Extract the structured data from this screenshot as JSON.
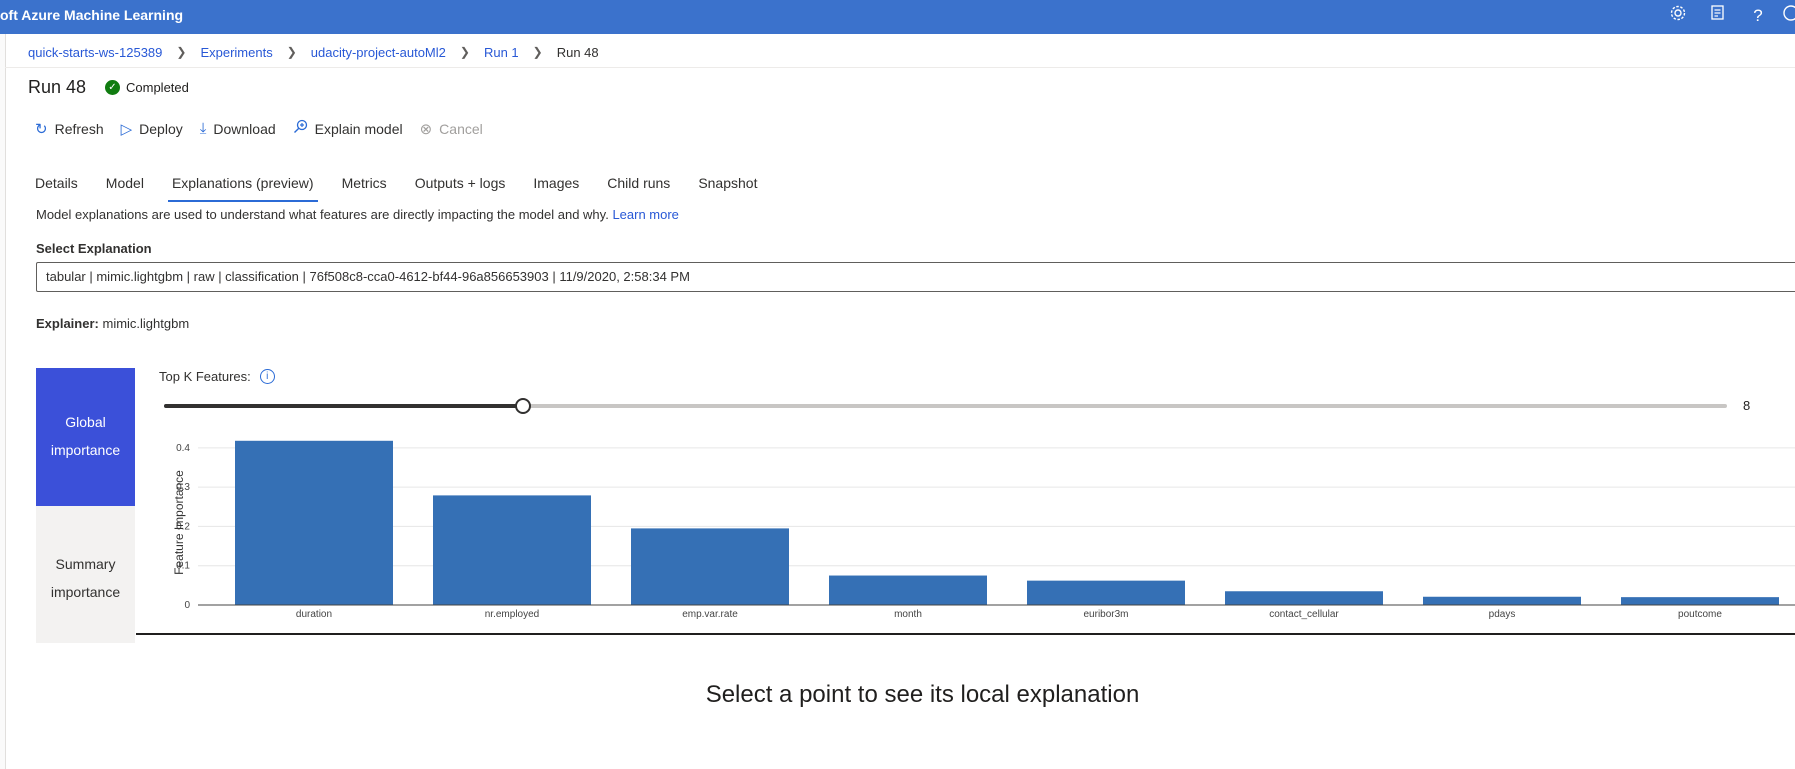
{
  "topbar": {
    "title": "oft Azure Machine Learning",
    "icons": [
      "gear-icon",
      "feedback-icon",
      "help-icon",
      "account-icon"
    ]
  },
  "breadcrumb": {
    "items": [
      "quick-starts-ws-125389",
      "Experiments",
      "udacity-project-autoMl2",
      "Run 1"
    ],
    "current": "Run 48"
  },
  "run": {
    "title": "Run 48",
    "status": "Completed"
  },
  "toolbar": {
    "refresh": "Refresh",
    "deploy": "Deploy",
    "download": "Download",
    "explain": "Explain model",
    "cancel": "Cancel"
  },
  "tabs": [
    {
      "label": "Details"
    },
    {
      "label": "Model"
    },
    {
      "label": "Explanations (preview)",
      "active": true
    },
    {
      "label": "Metrics"
    },
    {
      "label": "Outputs + logs"
    },
    {
      "label": "Images"
    },
    {
      "label": "Child runs"
    },
    {
      "label": "Snapshot"
    }
  ],
  "explanations": {
    "description": "Model explanations are used to understand what features are directly impacting the model and why.",
    "learn_more": "Learn more",
    "select_label": "Select Explanation",
    "selected_value": "tabular | mimic.lightgbm | raw | classification | 76f508c8-cca0-4612-bf44-96a856653903 | 11/9/2020, 2:58:34 PM",
    "explainer_label": "Explainer:",
    "explainer_value": "mimic.lightgbm",
    "side_tabs": {
      "global": "Global importance",
      "summary": "Summary importance"
    },
    "topk_label": "Top K Features:",
    "topk_value": "8",
    "topk_fraction": 0.23,
    "local_message": "Select a point to see its local explanation"
  },
  "colors": {
    "topbar": "#3b72cc",
    "bar": "#3570b5",
    "active_tab": "#3b50d9"
  },
  "chart_data": {
    "type": "bar",
    "categories": [
      "duration",
      "nr.employed",
      "emp.var.rate",
      "month",
      "euribor3m",
      "contact_cellular",
      "pdays",
      "poutcome"
    ],
    "values": [
      0.418,
      0.279,
      0.195,
      0.075,
      0.062,
      0.035,
      0.021,
      0.02
    ],
    "ylabel": "Feature Importance",
    "xlabel": "",
    "ylim": [
      0,
      0.42
    ],
    "yticks": [
      0,
      0.1,
      0.2,
      0.3,
      0.4
    ],
    "ytick_labels": [
      "0",
      "0.1",
      "0.2",
      "0.3",
      "0.4"
    ],
    "grid": true
  }
}
